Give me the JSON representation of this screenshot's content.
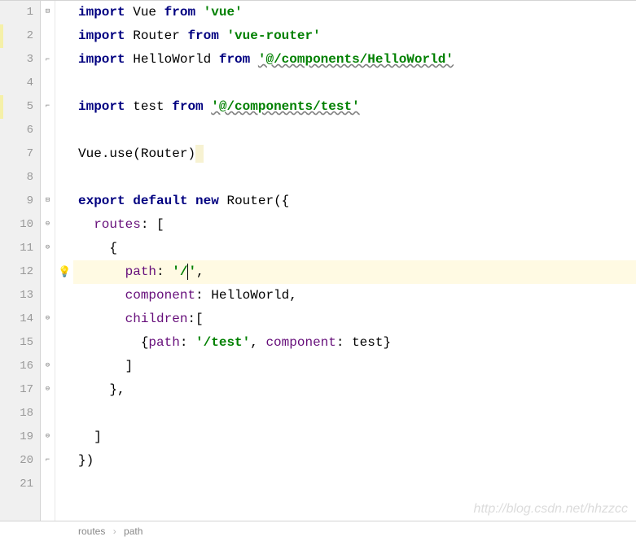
{
  "line_numbers": [
    "1",
    "2",
    "3",
    "4",
    "5",
    "6",
    "7",
    "8",
    "9",
    "10",
    "11",
    "12",
    "13",
    "14",
    "15",
    "16",
    "17",
    "18",
    "19",
    "20",
    "21"
  ],
  "highlighted_line": 12,
  "code": {
    "l1": {
      "kw1": "import",
      "id1": "Vue",
      "kw2": "from",
      "str": "'vue'"
    },
    "l2": {
      "kw1": "import",
      "id1": "Router",
      "kw2": "from",
      "str": "'vue-router'"
    },
    "l3": {
      "kw1": "import",
      "id1": "HelloWorld",
      "kw2": "from",
      "str": "'@/components/HelloWorld'"
    },
    "l5": {
      "kw1": "import",
      "id1": "test",
      "kw2": "from",
      "str": "'@/components/test'"
    },
    "l7": {
      "id1": "Vue",
      "dot": ".",
      "id2": "use",
      "open": "(",
      "id3": "Router",
      "close": ")"
    },
    "l9": {
      "kw1": "export",
      "kw2": "default",
      "kw3": "new",
      "id1": "Router",
      "open": "({"
    },
    "l10": {
      "prop": "routes",
      "rest": ": ["
    },
    "l11": {
      "open": "{"
    },
    "l12": {
      "prop": "path",
      "colon": ": ",
      "q1": "'",
      "val": "/",
      "q2": "'",
      "comma": ","
    },
    "l13": {
      "prop": "component",
      "rest": ": HelloWorld,"
    },
    "l14": {
      "prop": "children",
      "rest": ":["
    },
    "l15": {
      "open": "{",
      "prop1": "path",
      "c1": ": ",
      "str": "'/test'",
      "comma": ", ",
      "prop2": "component",
      "c2": ": ",
      "id": "test",
      "close": "}"
    },
    "l16": {
      "close": "]"
    },
    "l17": {
      "close": "},"
    },
    "l19": {
      "close": "]"
    },
    "l20": {
      "close": "})"
    }
  },
  "breadcrumb": {
    "a": "routes",
    "b": "path"
  },
  "watermark": "http://blog.csdn.net/hhzzcc"
}
